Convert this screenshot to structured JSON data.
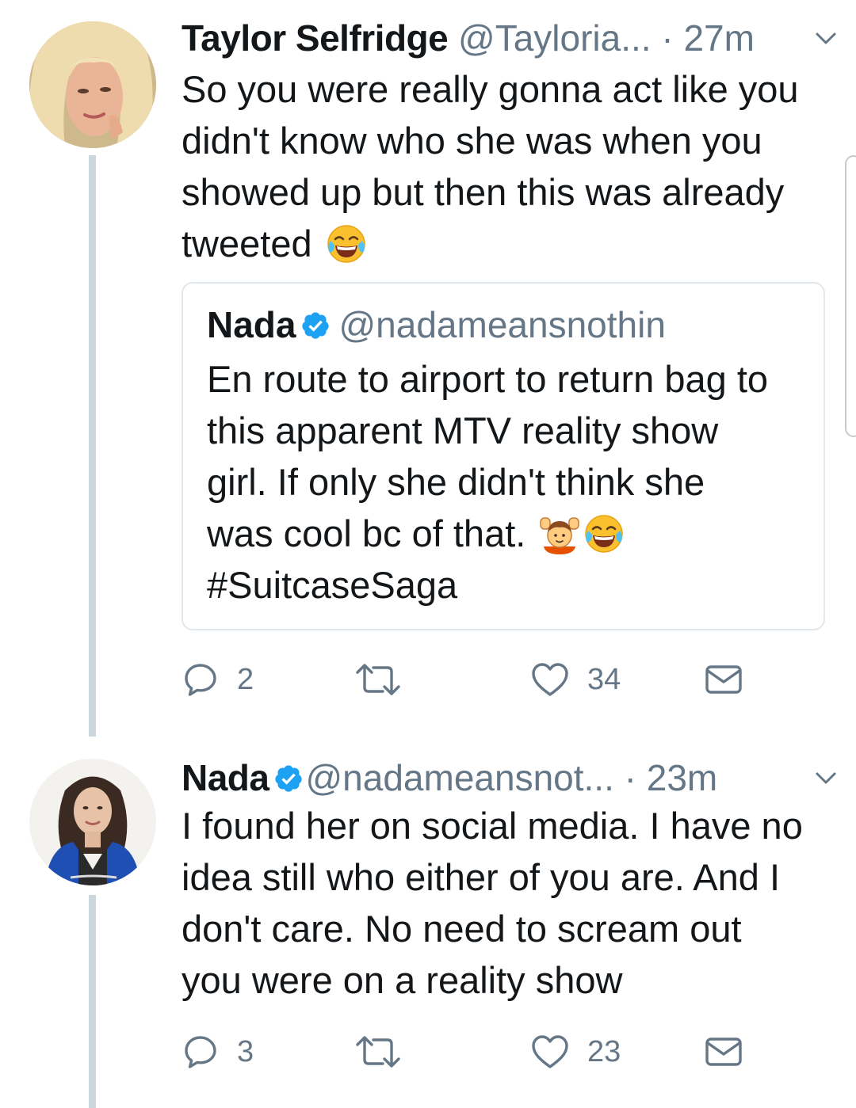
{
  "tweets": [
    {
      "author_name": "Taylor Selfridge",
      "author_handle": "@Tayloria...",
      "time": "· 27m",
      "text": "So you were really gonna act like you\ndidn't know who she was when you\nshowed up but then this was already\ntweeted",
      "text_emoji": "face-with-tears-of-joy",
      "quoted": {
        "author_name": "Nada",
        "verified": true,
        "author_handle": "@nadameansnothin",
        "text": "En route to airport to return bag to\nthis apparent MTV reality show\ngirl. If only she didn't think she\nwas cool bc of that.",
        "emojis": [
          "person-raising-both-hands",
          "face-with-tears-of-joy"
        ],
        "hashtag": "#SuitcaseSaga"
      },
      "actions": {
        "replies": "2",
        "retweets": "",
        "likes": "34"
      }
    },
    {
      "author_name": "Nada",
      "verified": true,
      "author_handle": "@nadameansnot...",
      "time": "· 23m",
      "text": "I found her on social media. I have no\nidea still who either of you are. And I\ndon't care. No need to scream out\nyou were on a reality show",
      "actions": {
        "replies": "3",
        "retweets": "",
        "likes": "23"
      }
    }
  ],
  "colors": {
    "secondary_text": "#657786",
    "thread_line": "#ccd6dd",
    "verified_blue": "#1da1f2",
    "border": "#e1e8ed"
  },
  "icons": [
    "reply-icon",
    "retweet-icon",
    "like-icon",
    "direct-message-icon",
    "verified-badge-icon",
    "chevron-down-icon"
  ]
}
